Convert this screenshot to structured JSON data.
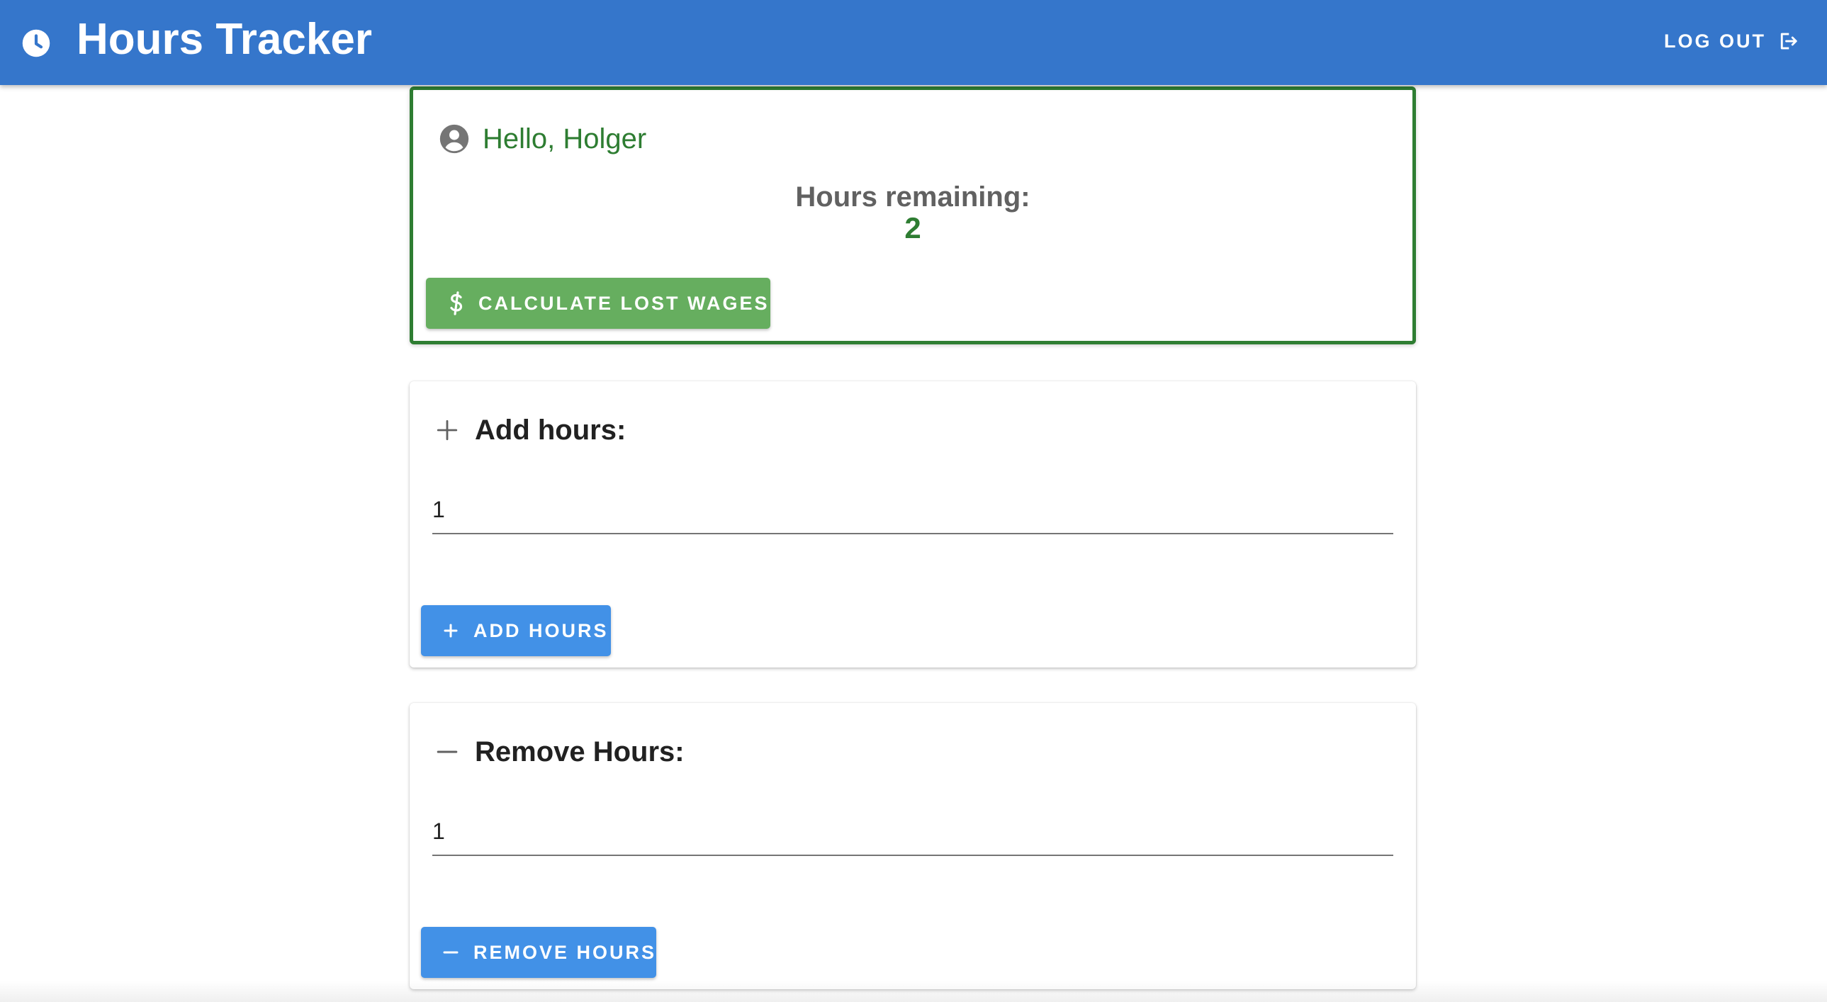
{
  "appbar": {
    "title": "Hours Tracker",
    "logout_label": "LOG OUT",
    "icons": {
      "app": "clock-icon",
      "logout": "logout-icon"
    }
  },
  "welcome": {
    "greeting": "Hello, Holger",
    "remaining_label": "Hours remaining:",
    "remaining_value": "2",
    "wages_button_label": "CALCULATE LOST WAGES",
    "icons": {
      "user": "account-circle-icon",
      "wages": "dollar-icon"
    }
  },
  "add_card": {
    "title": "Add hours:",
    "input_value": "1",
    "button_label": "ADD HOURS",
    "icons": {
      "header": "plus-icon",
      "button": "plus-icon"
    }
  },
  "remove_card": {
    "title": "Remove Hours:",
    "input_value": "1",
    "button_label": "REMOVE HOURS",
    "icons": {
      "header": "minus-icon",
      "button": "minus-icon"
    }
  },
  "colors": {
    "appbar": "#3576cb",
    "success": "#2e7d32",
    "wages_button": "#66ae5f",
    "primary_button": "#4291e7",
    "muted_text": "#616161"
  }
}
